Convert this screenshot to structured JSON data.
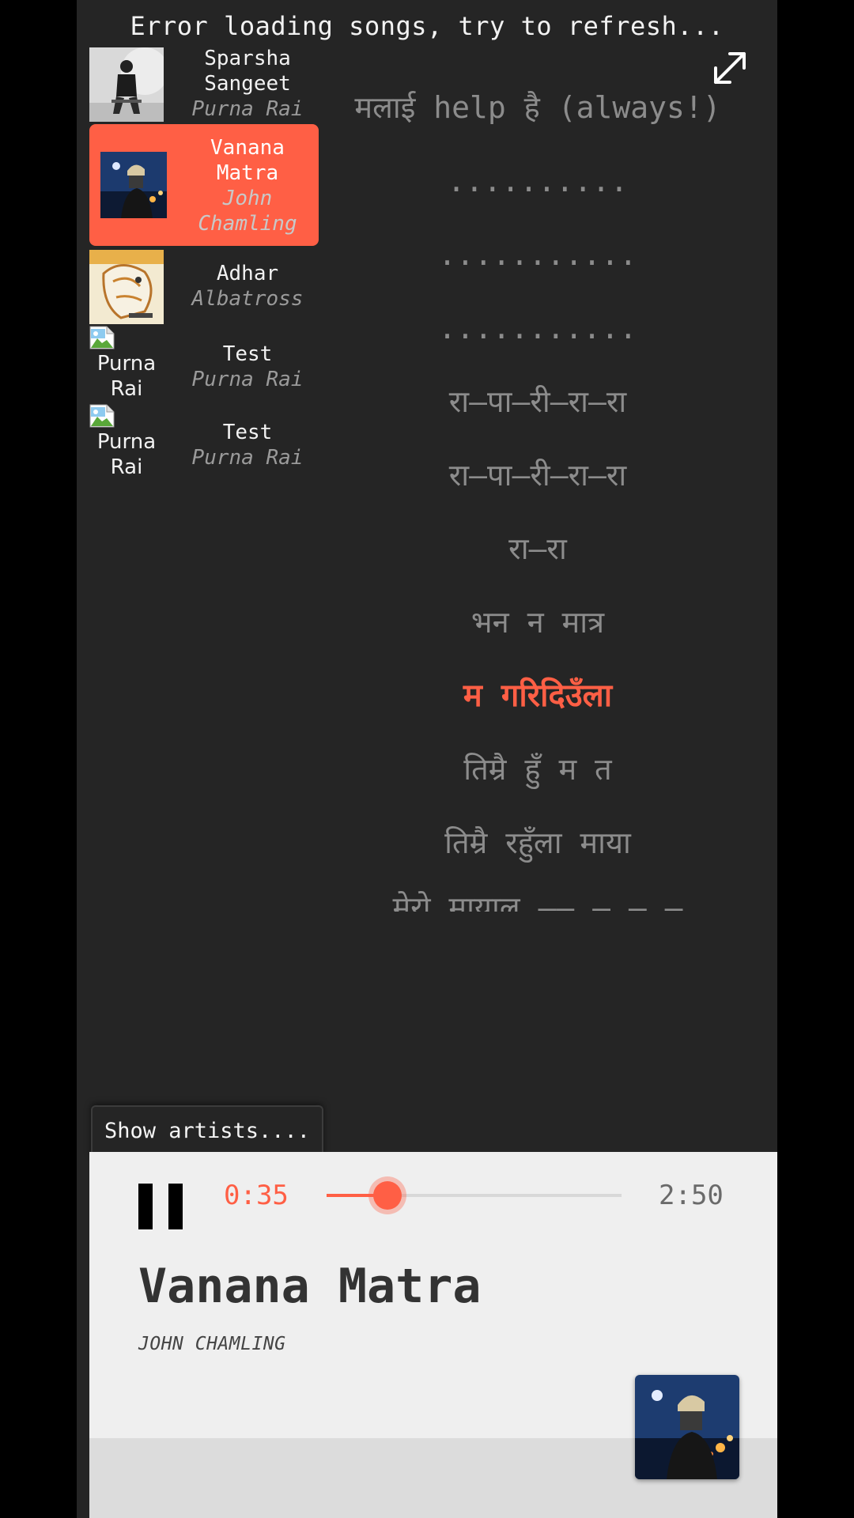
{
  "error_message": "Error loading songs, try to refresh...",
  "expand_icon": "expand-arrows-icon",
  "songs": [
    {
      "title": "Sparsha Sangeet",
      "artist": "Purna Rai",
      "thumb": "photo",
      "active": false
    },
    {
      "title": "Vanana Matra",
      "artist": "John Chamling",
      "thumb": "photo",
      "active": true
    },
    {
      "title": "Adhar",
      "artist": "Albatross",
      "thumb": "illustration",
      "active": false
    },
    {
      "title": "Test",
      "artist": "Purna Rai",
      "thumb": "broken",
      "alt": "Purna Rai",
      "active": false
    },
    {
      "title": "Test",
      "artist": "Purna Rai",
      "thumb": "broken",
      "alt": "Purna Rai",
      "active": false
    }
  ],
  "lyrics": [
    "मलाई help है (always!)",
    "..........",
    "...........",
    "...........",
    "रा–पा–री–रा–रा",
    "रा–पा–री–रा–रा",
    "रा–रा",
    "भन न मात्र",
    "म गरिदिउँला",
    "तिम्रै हुँ म त",
    "तिम्रै रहुँला माया",
    "मेरो मायालु –– – – –"
  ],
  "current_lyric_index": 8,
  "show_artists_label": "Show artists....",
  "player": {
    "elapsed": "0:35",
    "total": "2:50",
    "progress": 0.206,
    "title": "Vanana Matra",
    "artist": "JOHN CHAMLING"
  },
  "colors": {
    "accent": "#ff5f45",
    "background": "#252525",
    "player_bg": "#efefef"
  }
}
